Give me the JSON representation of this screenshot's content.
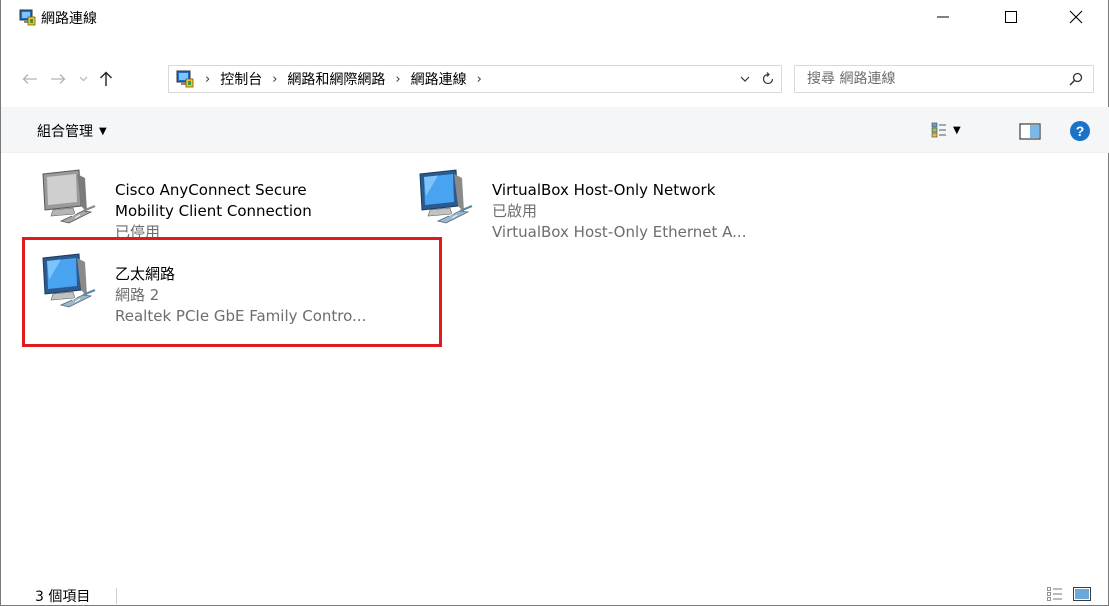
{
  "window": {
    "title": "網路連線",
    "minimize_icon": "minimize-icon",
    "maximize_icon": "maximize-icon",
    "close_icon": "close-icon"
  },
  "navigation": {
    "back_icon": "arrow-left-icon",
    "forward_icon": "arrow-right-icon",
    "recent_icon": "chevron-down-icon",
    "up_icon": "arrow-up-icon"
  },
  "address": {
    "crumbs": [
      "控制台",
      "網路和網際網路",
      "網路連線"
    ],
    "separator": "›"
  },
  "search": {
    "placeholder": "搜尋 網路連線"
  },
  "command_bar": {
    "organize_label": "組合管理"
  },
  "connections": [
    {
      "name_lines": [
        "Cisco AnyConnect Secure",
        "Mobility Client Connection"
      ],
      "status": "已停用",
      "device": ""
    },
    {
      "name_lines": [
        "VirtualBox Host-Only Network"
      ],
      "status": "已啟用",
      "device": "VirtualBox Host-Only Ethernet A..."
    },
    {
      "name_lines": [
        "乙太網路"
      ],
      "status": "網路 2",
      "device": "Realtek PCIe GbE Family Contro..."
    }
  ],
  "status_bar": {
    "item_count": "3 個項目"
  },
  "colors": {
    "highlight": "#e0191d",
    "help": "#1a73c8",
    "secondary_text": "#6d6d6d"
  }
}
